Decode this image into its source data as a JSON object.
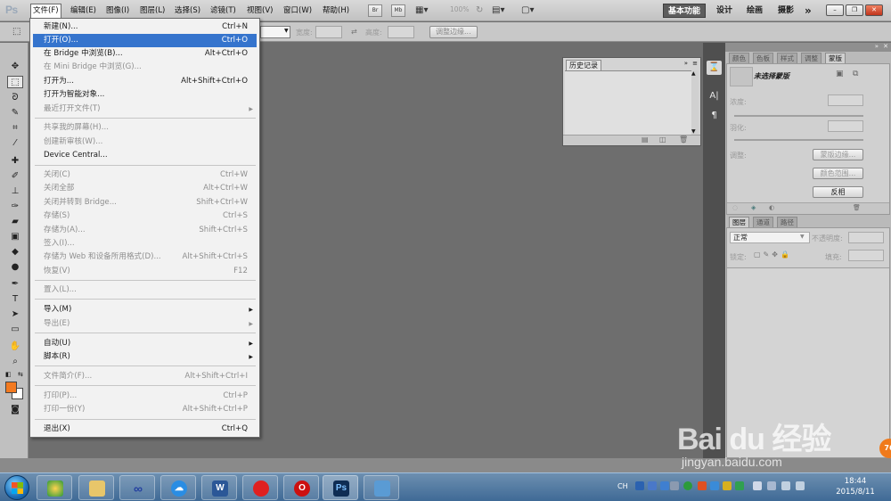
{
  "app": {
    "logo": "Ps"
  },
  "menubar": {
    "items": [
      "文件(F)",
      "编辑(E)",
      "图像(I)",
      "图层(L)",
      "选择(S)",
      "滤镜(T)",
      "视图(V)",
      "窗口(W)",
      "帮助(H)"
    ],
    "bridge_btn": "Br",
    "minibridge_btn": "Mb",
    "zoom": "100%",
    "workspaces": [
      "基本功能",
      "设计",
      "绘画",
      "摄影",
      "»"
    ]
  },
  "optbar": {
    "style_value": "",
    "width_label": "宽度:",
    "height_label": "高度:",
    "refine_edge": "调整边缘..."
  },
  "file_menu": {
    "items": [
      {
        "label": "新建(N)...",
        "shortcut": "Ctrl+N"
      },
      {
        "label": "打开(O)...",
        "shortcut": "Ctrl+O"
      },
      {
        "label": "在 Bridge 中浏览(B)...",
        "shortcut": "Alt+Ctrl+O"
      },
      {
        "label": "在 Mini Bridge 中浏览(G)...",
        "shortcut": ""
      },
      {
        "label": "打开为...",
        "shortcut": "Alt+Shift+Ctrl+O"
      },
      {
        "label": "打开为智能对象...",
        "shortcut": ""
      },
      {
        "label": "最近打开文件(T)",
        "shortcut": ""
      },
      {
        "label": "共享我的屏幕(H)...",
        "shortcut": ""
      },
      {
        "label": "创建新审核(W)...",
        "shortcut": ""
      },
      {
        "label": "Device Central...",
        "shortcut": ""
      },
      {
        "label": "关闭(C)",
        "shortcut": "Ctrl+W"
      },
      {
        "label": "关闭全部",
        "shortcut": "Alt+Ctrl+W"
      },
      {
        "label": "关闭并转到 Bridge...",
        "shortcut": "Shift+Ctrl+W"
      },
      {
        "label": "存储(S)",
        "shortcut": "Ctrl+S"
      },
      {
        "label": "存储为(A)...",
        "shortcut": "Shift+Ctrl+S"
      },
      {
        "label": "签入(I)...",
        "shortcut": ""
      },
      {
        "label": "存储为 Web 和设备所用格式(D)...",
        "shortcut": "Alt+Shift+Ctrl+S"
      },
      {
        "label": "恢复(V)",
        "shortcut": "F12"
      },
      {
        "label": "置入(L)...",
        "shortcut": ""
      },
      {
        "label": "导入(M)",
        "shortcut": ""
      },
      {
        "label": "导出(E)",
        "shortcut": ""
      },
      {
        "label": "自动(U)",
        "shortcut": ""
      },
      {
        "label": "脚本(R)",
        "shortcut": ""
      },
      {
        "label": "文件简介(F)...",
        "shortcut": "Alt+Shift+Ctrl+I"
      },
      {
        "label": "打印(P)...",
        "shortcut": "Ctrl+P"
      },
      {
        "label": "打印一份(Y)",
        "shortcut": "Alt+Shift+Ctrl+P"
      },
      {
        "label": "退出(X)",
        "shortcut": "Ctrl+Q"
      }
    ]
  },
  "history_panel": {
    "tab": "历史记录"
  },
  "masks_panel": {
    "tabs": [
      "颜色",
      "色板",
      "样式",
      "调整",
      "蒙版"
    ],
    "no_mask": "未选择蒙版",
    "density_label": "浓度:",
    "feather_label": "羽化:",
    "refine_label": "调整:",
    "mask_edge_btn": "蒙版边缘...",
    "color_range_btn": "颜色范围...",
    "invert_btn": "反相"
  },
  "layers_panel": {
    "tabs": [
      "图层",
      "通道",
      "路径"
    ],
    "blend_mode": "正常",
    "opacity_label": "不透明度:",
    "lock_label": "锁定:",
    "fill_label": "填充:"
  },
  "taskbar": {
    "apps": [
      "W",
      "O",
      "Ps"
    ],
    "lang": "CH",
    "time": "18:44",
    "date": "2015/8/11"
  },
  "watermark": {
    "logo": "Bai du 经验",
    "site": "jingyan.baidu.com",
    "badge": "76"
  },
  "colors": {
    "highlight": "#3574cd",
    "foreground": "#f37a20",
    "background": "#ffffff"
  }
}
